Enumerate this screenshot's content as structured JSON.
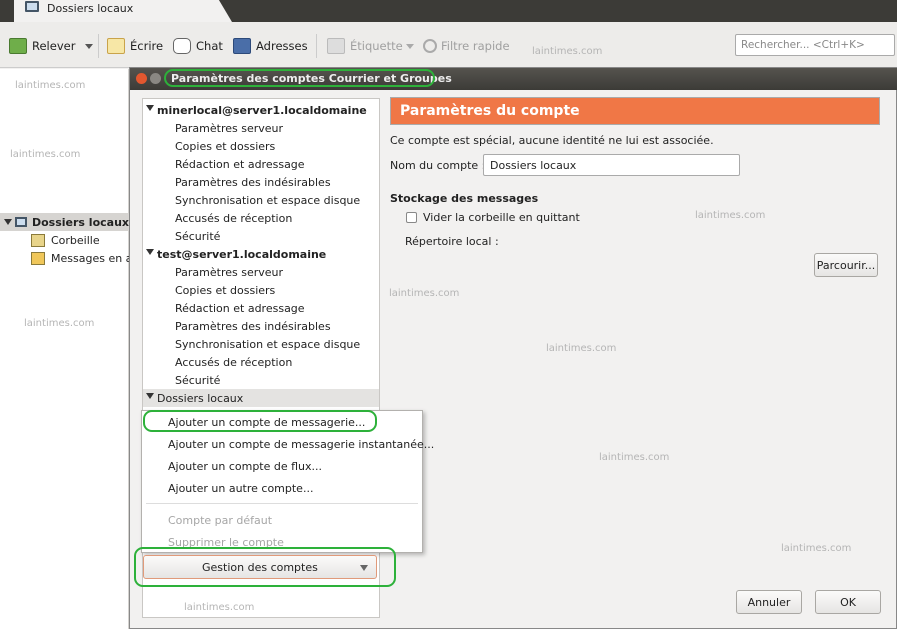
{
  "window": {
    "tab_title": "Dossiers locaux"
  },
  "toolbar": {
    "relever": "Relever",
    "ecrire": "Écrire",
    "chat": "Chat",
    "adresses": "Adresses",
    "etiquette": "Étiquette",
    "filtre": "Filtre rapide",
    "search_placeholder": "Rechercher... <Ctrl+K>"
  },
  "left_pane": {
    "folder": "Dossiers locaux",
    "items": [
      "Corbeille",
      "Messages en at"
    ]
  },
  "watermark": "laintimes.com",
  "dialog": {
    "title": "Paramètres des comptes Courrier et Groupes",
    "tree": [
      {
        "label": "minerlocal@server1.localdomaine",
        "type": "account"
      },
      {
        "label": "Paramètres serveur",
        "type": "sub"
      },
      {
        "label": "Copies et dossiers",
        "type": "sub"
      },
      {
        "label": "Rédaction et adressage",
        "type": "sub"
      },
      {
        "label": "Paramètres des indésirables",
        "type": "sub"
      },
      {
        "label": "Synchronisation et espace disque",
        "type": "sub"
      },
      {
        "label": "Accusés de réception",
        "type": "sub"
      },
      {
        "label": "Sécurité",
        "type": "sub"
      },
      {
        "label": "test@server1.localdomaine",
        "type": "account"
      },
      {
        "label": "Paramètres serveur",
        "type": "sub"
      },
      {
        "label": "Copies et dossiers",
        "type": "sub"
      },
      {
        "label": "Rédaction et adressage",
        "type": "sub"
      },
      {
        "label": "Paramètres des indésirables",
        "type": "sub"
      },
      {
        "label": "Synchronisation et espace disque",
        "type": "sub"
      },
      {
        "label": "Accusés de réception",
        "type": "sub"
      },
      {
        "label": "Sécurité",
        "type": "sub"
      },
      {
        "label": "Dossiers locaux",
        "type": "account-selected"
      }
    ],
    "panel": {
      "header": "Paramètres du compte",
      "notice": "Ce compte est spécial, aucune identité ne lui est associée.",
      "account_name_label": "Nom du compte :",
      "account_name_value": "Dossiers locaux",
      "storage_heading": "Stockage des messages",
      "empty_trash_label": "Vider la corbeille en quittant",
      "empty_trash_checked": false,
      "local_dir_label": "Répertoire local :",
      "browse_button": "Parcourir..."
    },
    "menu": {
      "items": [
        {
          "label": "Ajouter un compte de messagerie...",
          "enabled": true
        },
        {
          "label": "Ajouter un compte de messagerie instantanée...",
          "enabled": true
        },
        {
          "label": "Ajouter un compte de flux...",
          "enabled": true
        },
        {
          "label": "Ajouter un autre compte...",
          "enabled": true
        },
        {
          "label": "Compte par défaut",
          "enabled": false
        },
        {
          "label": "Supprimer le compte",
          "enabled": false
        }
      ]
    },
    "gestion_button": "Gestion des comptes",
    "cancel_button": "Annuler",
    "ok_button": "OK"
  },
  "colors": {
    "header_orange": "#f07746",
    "highlight_green": "#2db13a"
  }
}
